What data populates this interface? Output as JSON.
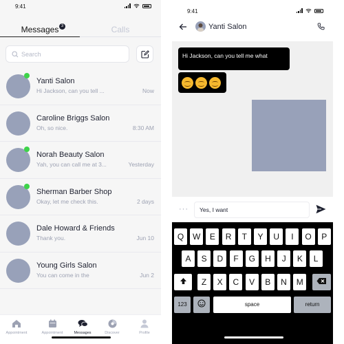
{
  "inbox": {
    "status_time": "9:41",
    "tabs": {
      "messages": "Messages",
      "calls": "Calls",
      "messages_badge": "3"
    },
    "search": {
      "placeholder": "Search"
    },
    "conversations": [
      {
        "name": "Yanti Salon",
        "preview": "Hi Jackson, can you tell ...",
        "time": "Now",
        "online": true
      },
      {
        "name": "Caroline Briggs Salon",
        "preview": "Oh, so nice.",
        "time": "8:30 AM",
        "online": false
      },
      {
        "name": "Norah Beauty Salon",
        "preview": "Yah, you can call me at 3...",
        "time": "Yesterday",
        "online": true
      },
      {
        "name": "Sherman Barber Shop",
        "preview": "Okay, let me check this.",
        "time": "2 days",
        "online": true
      },
      {
        "name": "Dale Howard & Friends",
        "preview": "Thank you.",
        "time": "Jun 10",
        "online": false
      },
      {
        "name": "Young Girls Salon",
        "preview": "You can come in the",
        "time": "Jun 2",
        "online": false
      }
    ],
    "bottom_nav": [
      {
        "label": "Appointment",
        "icon": "home-icon"
      },
      {
        "label": "Appointment",
        "icon": "calendar-icon"
      },
      {
        "label": "Messages",
        "icon": "chat-icon",
        "active": true
      },
      {
        "label": "Discover",
        "icon": "discover-icon"
      },
      {
        "label": "Profile",
        "icon": "profile-icon"
      }
    ]
  },
  "chat": {
    "status_time": "9:41",
    "contact_name": "Yanti Salon",
    "messages": {
      "text": "Hi Jackson, can you tell me what",
      "emoji_count": 3
    },
    "input_value": "Yes, I want",
    "more_label": "···"
  },
  "keyboard": {
    "row1": [
      "Q",
      "W",
      "E",
      "R",
      "T",
      "Y",
      "U",
      "I",
      "O",
      "P"
    ],
    "row2": [
      "A",
      "S",
      "D",
      "F",
      "G",
      "H",
      "J",
      "K",
      "L"
    ],
    "row3": [
      "Z",
      "X",
      "C",
      "V",
      "B",
      "N",
      "M"
    ],
    "numbers_key": "123",
    "space_key": "space",
    "return_key": "return"
  },
  "colors": {
    "avatar": "#98a1b9",
    "online": "#3ed34a",
    "text_primary": "#1e2130",
    "text_muted": "#9da2b3",
    "chat_bg": "#f0f0f0",
    "bubble": "#000000",
    "keyboard_bg": "#000000"
  }
}
